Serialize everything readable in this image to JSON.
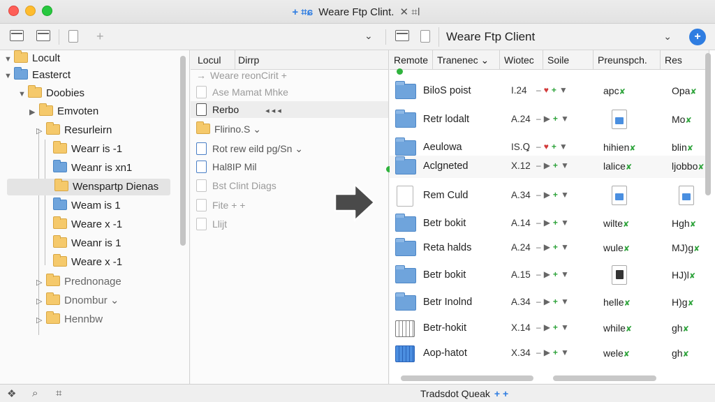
{
  "window": {
    "title": "Weare Ftp Clint.",
    "title_prefix_glyph": "+ ⌗ɕ",
    "title_suffix_glyph": "✕ ⌗ǀ"
  },
  "toolbar": {
    "address": "Weare Ftp Client",
    "address_chevron": "⌄",
    "add_button": "+"
  },
  "tree": {
    "items": [
      {
        "label": "Locult",
        "disc": "▼",
        "color": "yellow"
      },
      {
        "label": "Easterct",
        "disc": "▼",
        "color": "blue"
      },
      {
        "label": "Doobies",
        "disc": "▼",
        "color": "yellow"
      },
      {
        "label": "Emvoten",
        "disc": "▶",
        "color": "yellow"
      },
      {
        "label": "Resurleirn",
        "disc": "▷",
        "color": "yellow"
      },
      {
        "label": "Wearr is -1",
        "color": "yellow"
      },
      {
        "label": "Weanr is xn1",
        "color": "blue"
      },
      {
        "label": "Wenspartp Dienas",
        "color": "yellow",
        "selected": true
      },
      {
        "label": "Weam is 1",
        "color": "blue"
      },
      {
        "label": "Weare x -1",
        "color": "yellow"
      },
      {
        "label": "Weanr is 1",
        "color": "yellow"
      },
      {
        "label": "Weare x -1",
        "color": "yellow"
      },
      {
        "label": "Prednonage",
        "disc": "▷",
        "color": "yellow",
        "muted": true
      },
      {
        "label": "Dnombur ⌄",
        "disc": "▷",
        "color": "yellow",
        "muted": true
      },
      {
        "label": "Hennbw",
        "disc": "▷",
        "color": "yellow",
        "muted": true
      }
    ]
  },
  "middle": {
    "headers": [
      "Locul",
      "Dirrp"
    ],
    "rows": [
      {
        "label": "Weare reonCirit",
        "prefix": "→",
        "suffix": "+",
        "faint": true
      },
      {
        "label": "Ase Mamat Mhke",
        "faint": true
      },
      {
        "label": "Rerbo",
        "selected": true,
        "controls": "◂   ◂   ◂"
      },
      {
        "label": "Flirino.S ⌄",
        "folder": true
      },
      {
        "label": "Rot rew eild pg/Sn ⌄",
        "blue": true
      },
      {
        "label": "Hal8IP Mil",
        "blue": true
      },
      {
        "label": "Bst Clint Diags",
        "faint": true
      },
      {
        "label": "Fite + +",
        "faint": true
      },
      {
        "label": "Llijt",
        "faint": true
      }
    ]
  },
  "right": {
    "headers": [
      "Remote",
      "Tranenec ⌄",
      "Wiotec",
      "Soile",
      "Preunspch.",
      "Res"
    ],
    "rows": [
      {
        "name": "BiloS poist",
        "size": "I.24",
        "icon": "folder",
        "preview": "apc",
        "result": "Opa",
        "redArrow": true
      },
      {
        "name": "Retr lodalt",
        "size": "A.24",
        "icon": "folder",
        "preview_doc": "blue",
        "result": "Mo"
      },
      {
        "name": "Aeulowa",
        "size": "IS.Ꝗ",
        "icon": "folder",
        "preview": "hihien",
        "result": "blin",
        "redArrow": true
      },
      {
        "name": "Aclgneted",
        "size": "X.12",
        "icon": "folder",
        "preview": "lalice",
        "result": "ljobbo",
        "selected": true
      },
      {
        "name": "Rem Culd",
        "size": "A.34",
        "icon": "doc",
        "preview_doc": "blue",
        "result_doc": "blue"
      },
      {
        "name": "Betr bokit",
        "size": "A.14",
        "icon": "folder",
        "preview": "wilte",
        "result": "Hgh"
      },
      {
        "name": "Reta halds",
        "size": "A.24",
        "icon": "folder",
        "preview": "wule",
        "result": "MJ)g"
      },
      {
        "name": "Betr bokit",
        "size": "A.15",
        "icon": "folder",
        "preview_doc": "dark",
        "result": "HJ)l"
      },
      {
        "name": "Betr Inolnd",
        "size": "A.34",
        "icon": "folder",
        "preview": "helle",
        "result": "H)g"
      },
      {
        "name": "Betr-hokit",
        "size": "X.14",
        "icon": "grid",
        "preview": "while",
        "result": "gh"
      },
      {
        "name": "Aop-hatot",
        "size": "X.34",
        "icon": "gridblue",
        "preview": "wele",
        "result": "gh"
      }
    ]
  },
  "status": {
    "text": "Tradsdot Queak",
    "extra": "+ +"
  },
  "colors": {
    "accent": "#2f7de1",
    "folder_yellow": "#f5c96b",
    "folder_blue": "#6fa4dc",
    "ok_green": "#2ea33b",
    "close_red": "#fe5f57",
    "min_yellow": "#febc2e",
    "max_green": "#28c840"
  }
}
